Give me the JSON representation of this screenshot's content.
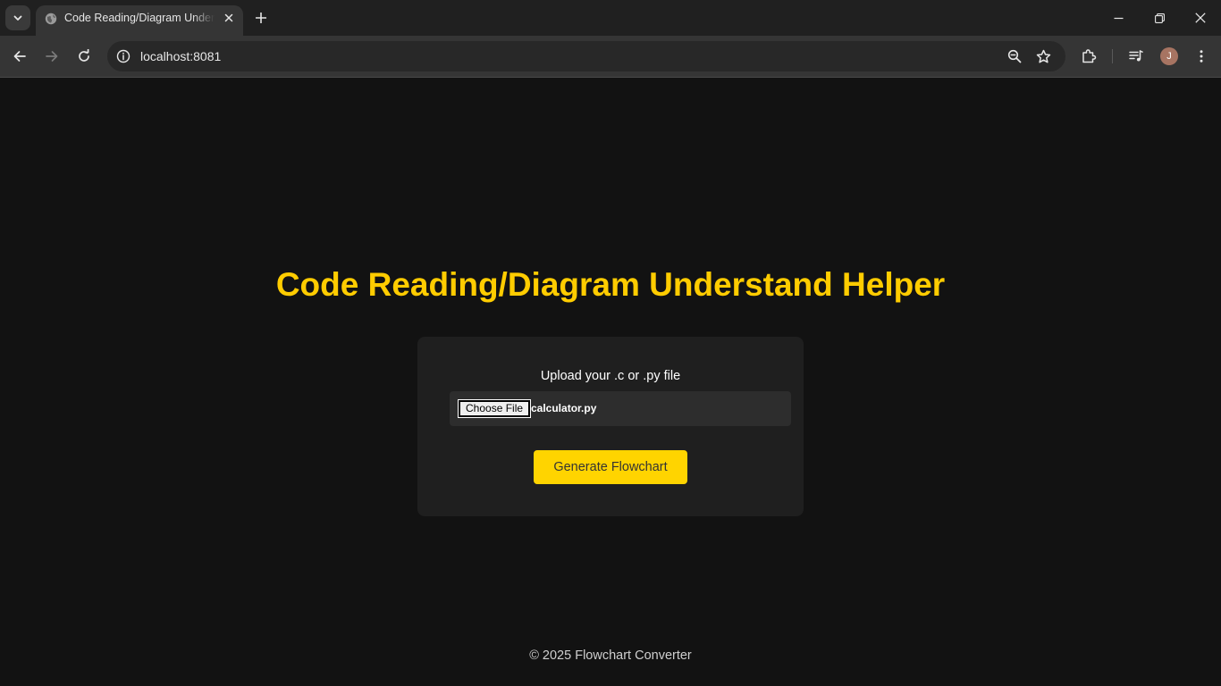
{
  "browser": {
    "tab": {
      "title": "Code Reading/Diagram Understand Helper"
    },
    "address_bar": {
      "url": "localhost:8081"
    },
    "profile": {
      "initial": "J"
    }
  },
  "page": {
    "title": "Code Reading/Diagram Understand Helper",
    "upload": {
      "label": "Upload your .c or .py file",
      "choose_button": "Choose File",
      "selected_file": "calculator.py"
    },
    "generate_button": "Generate Flowchart",
    "footer": "© 2025 Flowchart Converter"
  },
  "colors": {
    "accent": "#ffcc00",
    "button": "#ffd400",
    "background": "#121212",
    "card": "#1f1f1f"
  }
}
